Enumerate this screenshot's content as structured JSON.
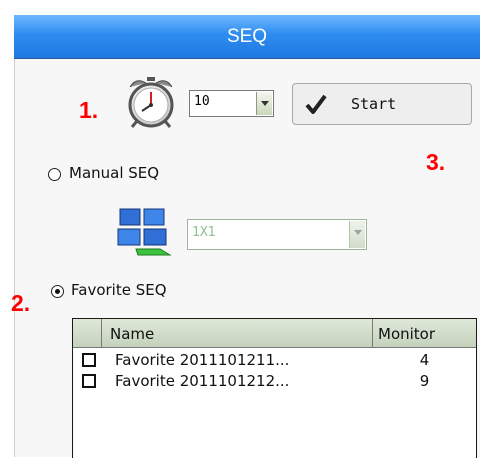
{
  "header": {
    "title": "SEQ"
  },
  "annotations": {
    "one": "1.",
    "two": "2.",
    "three": "3."
  },
  "timer": {
    "icon": "alarm-clock-icon",
    "interval_value": "10"
  },
  "start_button": {
    "icon": "checkmark-icon",
    "label": "Start"
  },
  "manual_seq": {
    "label": "Manual SEQ",
    "selected": false,
    "layout_icon": "monitor-grid-icon",
    "layout_value": "1X1"
  },
  "favorite_seq": {
    "label": "Favorite SEQ",
    "selected": true
  },
  "favorites_table": {
    "columns": [
      "Name",
      "Monitor"
    ],
    "rows": [
      {
        "name": "Favorite 2011101211...",
        "monitor": "4",
        "checked": false
      },
      {
        "name": "Favorite 2011101212...",
        "monitor": "9",
        "checked": false
      }
    ]
  },
  "colors": {
    "header": "#2e8cf0",
    "annotation": "#ff0000"
  }
}
